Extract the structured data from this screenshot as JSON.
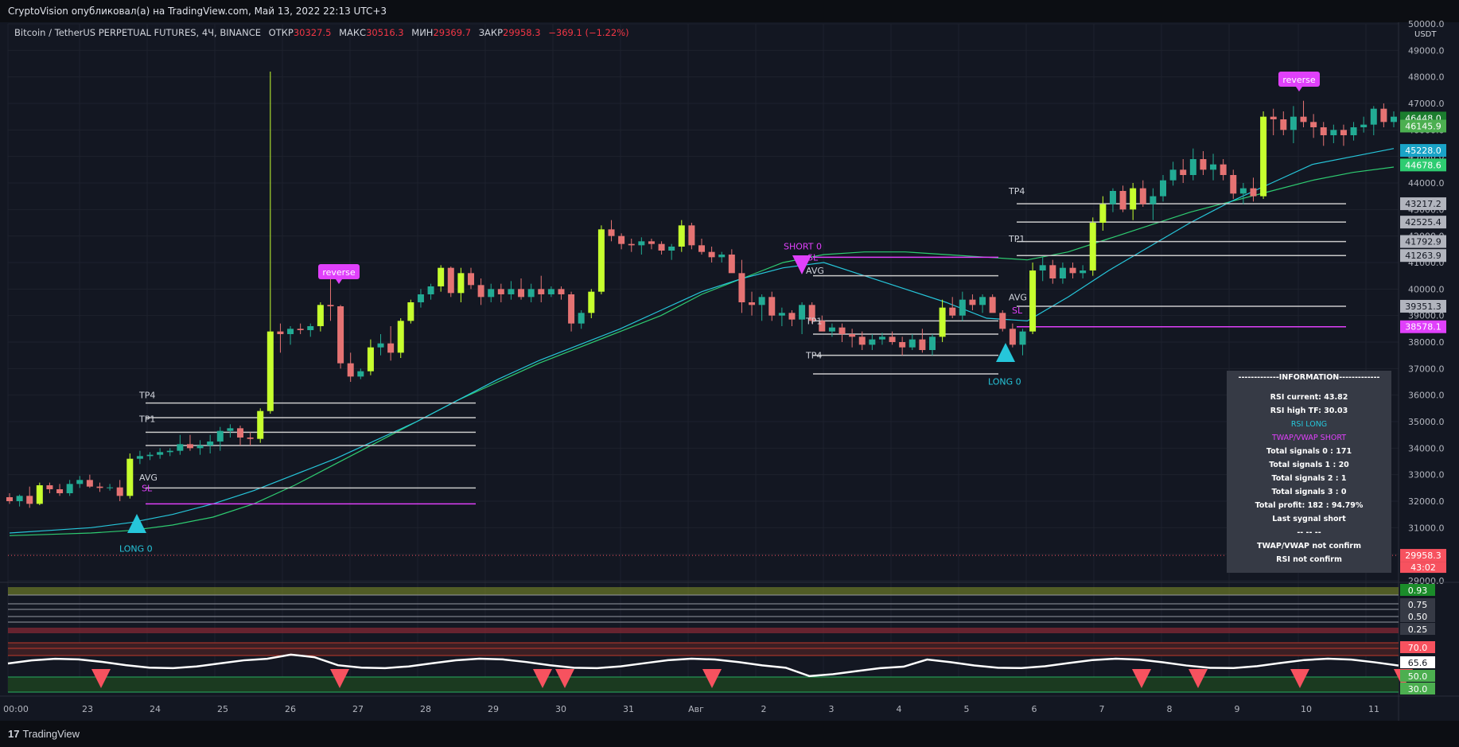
{
  "header": {
    "published": "CryptoVision опубликовал(а) на TradingView.com, Май 13, 2022 22:13 UTC+3"
  },
  "legend": {
    "symbol": "Bitcoin / TetherUS PERPETUAL FUTURES, 4Ч, BINANCE",
    "open_label": "ОТКР",
    "open": "30327.5",
    "high_label": "МАКС",
    "high": "30516.3",
    "low_label": "МИН",
    "low": "29369.7",
    "close_label": "ЗАКР",
    "close": "29958.3",
    "change": "−369.1 (−1.22%)"
  },
  "footer": {
    "brand_mark": "17",
    "brand": "TradingView"
  },
  "currency": "USDT",
  "colors": {
    "background": "#131722",
    "up": "#22ab94",
    "down": "#f23645",
    "lime": "#c6ff2e",
    "salmon": "#e57373",
    "vwap_fast": "#26c6da",
    "vwap_slow": "#2ecc71",
    "magenta": "#e040fb",
    "level": "#c9c9c9",
    "cyan_marker": "#26c6da"
  },
  "info_panel": {
    "title": "-------------INFORMATION-------------",
    "rsi_current": "RSI current: 43.82",
    "rsi_high": "RSI high TF: 30.03",
    "rsi_long": "RSI LONG",
    "twap_short": "TWAP/VWAP SHORT",
    "total0": "Total signals 0 : 171",
    "total1": "Total signals 1 : 20",
    "total2": "Total signals 2 : 1",
    "total3": "Total signals 3 : 0",
    "profit": "Total profit: 182 : 94.79%",
    "last": "Last sygnal short",
    "sep": "-- -- --",
    "twap_nc": "TWAP/VWAP not confirm",
    "rsi_nc": "RSI not confirm"
  },
  "chart_data": {
    "type": "candlestick",
    "title": "Bitcoin / TetherUS PERPETUAL FUTURES, 4Ч, BINANCE",
    "x_ticks": [
      "00:00",
      "23",
      "24",
      "25",
      "26",
      "27",
      "28",
      "29",
      "30",
      "31",
      "Авг",
      "2",
      "3",
      "4",
      "5",
      "6",
      "7",
      "8",
      "9",
      "10",
      "11"
    ],
    "y_ticks": [
      29000,
      30000,
      31000,
      32000,
      33000,
      34000,
      35000,
      36000,
      37000,
      38000,
      39000,
      40000,
      41000,
      42000,
      43000,
      44000,
      45000,
      46000,
      47000,
      48000,
      49000,
      50000
    ],
    "ylim": [
      29000,
      50000
    ],
    "candles": [
      [
        32150,
        32300,
        31900,
        32000
      ],
      [
        32000,
        32250,
        31800,
        32200
      ],
      [
        32200,
        32550,
        31750,
        31900
      ],
      [
        31900,
        32700,
        31850,
        32600
      ],
      [
        32600,
        32700,
        32300,
        32450
      ],
      [
        32450,
        32650,
        32200,
        32300
      ],
      [
        32300,
        32800,
        32200,
        32650
      ],
      [
        32650,
        32950,
        32500,
        32800
      ],
      [
        32800,
        33000,
        32500,
        32550
      ],
      [
        32550,
        32700,
        32350,
        32500
      ],
      [
        32500,
        32650,
        32400,
        32520
      ],
      [
        32520,
        32800,
        32000,
        32200
      ],
      [
        32200,
        33800,
        32100,
        33600
      ],
      [
        33600,
        33900,
        33400,
        33700
      ],
      [
        33700,
        33850,
        33550,
        33750
      ],
      [
        33750,
        34000,
        33600,
        33850
      ],
      [
        33850,
        34000,
        33700,
        33900
      ],
      [
        33900,
        34500,
        33750,
        34150
      ],
      [
        34150,
        34500,
        33900,
        34000
      ],
      [
        34000,
        34300,
        33750,
        34100
      ],
      [
        34100,
        34500,
        33800,
        34250
      ],
      [
        34250,
        34800,
        33900,
        34650
      ],
      [
        34650,
        34900,
        34400,
        34750
      ],
      [
        34750,
        34850,
        34100,
        34400
      ],
      [
        34400,
        34600,
        34100,
        34350
      ],
      [
        34350,
        35500,
        34200,
        35400
      ],
      [
        35400,
        48200,
        35300,
        38400
      ],
      [
        38400,
        38700,
        37600,
        38300
      ],
      [
        38300,
        38600,
        37900,
        38500
      ],
      [
        38500,
        38700,
        38300,
        38450
      ],
      [
        38450,
        38700,
        38200,
        38600
      ],
      [
        38600,
        39500,
        38400,
        39400
      ],
      [
        39400,
        40400,
        38800,
        39350
      ],
      [
        39350,
        39400,
        37000,
        37200
      ],
      [
        37200,
        37600,
        36500,
        36700
      ],
      [
        36700,
        37000,
        36600,
        36900
      ],
      [
        36900,
        38100,
        36750,
        37800
      ],
      [
        37800,
        38300,
        37500,
        37950
      ],
      [
        37950,
        38600,
        37300,
        37600
      ],
      [
        37600,
        38900,
        37400,
        38800
      ],
      [
        38800,
        39600,
        38700,
        39500
      ],
      [
        39500,
        40000,
        39300,
        39800
      ],
      [
        39800,
        40200,
        39600,
        40100
      ],
      [
        40100,
        40900,
        39900,
        40800
      ],
      [
        40800,
        40850,
        39700,
        39850
      ],
      [
        39850,
        40800,
        39500,
        40600
      ],
      [
        40600,
        40800,
        40000,
        40150
      ],
      [
        40150,
        40400,
        39400,
        39700
      ],
      [
        39700,
        40200,
        39500,
        40000
      ],
      [
        40000,
        40200,
        39500,
        39800
      ],
      [
        39800,
        40300,
        39600,
        40000
      ],
      [
        40000,
        40400,
        39600,
        39700
      ],
      [
        39700,
        40200,
        39500,
        40000
      ],
      [
        40000,
        40500,
        39500,
        39800
      ],
      [
        39800,
        40100,
        39700,
        40000
      ],
      [
        40000,
        40100,
        39600,
        39800
      ],
      [
        39800,
        39900,
        38400,
        38700
      ],
      [
        38700,
        39200,
        38500,
        39100
      ],
      [
        39100,
        40000,
        38900,
        39900
      ],
      [
        39900,
        42400,
        39800,
        42250
      ],
      [
        42250,
        42600,
        41800,
        42000
      ],
      [
        42000,
        42100,
        41500,
        41700
      ],
      [
        41700,
        41900,
        41400,
        41650
      ],
      [
        41650,
        41950,
        41300,
        41800
      ],
      [
        41800,
        41900,
        41500,
        41700
      ],
      [
        41700,
        41800,
        41300,
        41450
      ],
      [
        41450,
        41700,
        41100,
        41600
      ],
      [
        41600,
        42600,
        41400,
        42400
      ],
      [
        42400,
        42500,
        41500,
        41650
      ],
      [
        41650,
        41900,
        41300,
        41400
      ],
      [
        41400,
        41600,
        41000,
        41200
      ],
      [
        41200,
        41400,
        41000,
        41300
      ],
      [
        41300,
        41500,
        40800,
        40600
      ],
      [
        40600,
        41100,
        39100,
        39500
      ],
      [
        39500,
        39900,
        39000,
        39400
      ],
      [
        39400,
        39800,
        38800,
        39700
      ],
      [
        39700,
        39900,
        38800,
        39000
      ],
      [
        39000,
        39300,
        38600,
        39100
      ],
      [
        39100,
        39200,
        38600,
        38850
      ],
      [
        38850,
        39500,
        38300,
        39400
      ],
      [
        39400,
        39500,
        38700,
        38800
      ],
      [
        38800,
        39000,
        38500,
        38400
      ],
      [
        38400,
        38700,
        38200,
        38550
      ],
      [
        38550,
        38700,
        38000,
        38300
      ],
      [
        38300,
        38500,
        37800,
        38200
      ],
      [
        38200,
        38400,
        37700,
        37900
      ],
      [
        37900,
        38300,
        37700,
        38100
      ],
      [
        38100,
        38350,
        37900,
        38200
      ],
      [
        38200,
        38400,
        37900,
        38000
      ],
      [
        38000,
        38200,
        37500,
        37800
      ],
      [
        37800,
        38300,
        37700,
        38100
      ],
      [
        38100,
        38500,
        37600,
        37700
      ],
      [
        37700,
        38300,
        37500,
        38200
      ],
      [
        38200,
        39600,
        38000,
        39300
      ],
      [
        39300,
        39700,
        38900,
        39000
      ],
      [
        39000,
        39900,
        38800,
        39600
      ],
      [
        39600,
        39800,
        39200,
        39400
      ],
      [
        39400,
        39800,
        39100,
        39700
      ],
      [
        39700,
        39800,
        39200,
        39100
      ],
      [
        39100,
        39200,
        38400,
        38500
      ],
      [
        38500,
        38700,
        37800,
        37900
      ],
      [
        37900,
        38500,
        37500,
        38400
      ],
      [
        38400,
        41000,
        38300,
        40700
      ],
      [
        40700,
        41200,
        40300,
        40900
      ],
      [
        40900,
        41100,
        40200,
        40400
      ],
      [
        40400,
        41000,
        40200,
        40800
      ],
      [
        40800,
        41000,
        40400,
        40600
      ],
      [
        40600,
        40900,
        40400,
        40700
      ],
      [
        40700,
        42700,
        40500,
        42500
      ],
      [
        42500,
        43500,
        42200,
        43200
      ],
      [
        43200,
        43800,
        42900,
        43700
      ],
      [
        43700,
        43900,
        42900,
        43000
      ],
      [
        43000,
        44000,
        42600,
        43800
      ],
      [
        43800,
        44100,
        43100,
        43200
      ],
      [
        43200,
        43800,
        42600,
        43500
      ],
      [
        43500,
        44300,
        43300,
        44100
      ],
      [
        44100,
        44800,
        43900,
        44500
      ],
      [
        44500,
        44900,
        44000,
        44300
      ],
      [
        44300,
        45300,
        44100,
        44900
      ],
      [
        44900,
        45200,
        44300,
        44500
      ],
      [
        44500,
        45100,
        44100,
        44700
      ],
      [
        44700,
        44900,
        44100,
        44300
      ],
      [
        44300,
        44500,
        43400,
        43600
      ],
      [
        43600,
        44000,
        43200,
        43800
      ],
      [
        43800,
        44200,
        43300,
        43500
      ],
      [
        43500,
        46700,
        43400,
        46500
      ],
      [
        46500,
        46800,
        45800,
        46400
      ],
      [
        46400,
        46700,
        45800,
        46000
      ],
      [
        46000,
        46900,
        45500,
        46500
      ],
      [
        46500,
        47100,
        46100,
        46300
      ],
      [
        46300,
        46600,
        45700,
        46100
      ],
      [
        46100,
        46300,
        45400,
        45800
      ],
      [
        45800,
        46200,
        45500,
        46000
      ],
      [
        46000,
        46200,
        45400,
        45800
      ],
      [
        45800,
        46300,
        45600,
        46100
      ],
      [
        46100,
        46500,
        45900,
        46200
      ],
      [
        46200,
        46900,
        45800,
        46800
      ],
      [
        46800,
        47000,
        46100,
        46300
      ],
      [
        46300,
        46700,
        46100,
        46500
      ]
    ],
    "vwap_fast": [
      30800,
      30900,
      31000,
      31200,
      31500,
      31900,
      32400,
      33000,
      33600,
      34300,
      35000,
      35800,
      36600,
      37300,
      37900,
      38500,
      39200,
      39900,
      40400,
      40800,
      41000,
      40500,
      40000,
      39500,
      38900,
      38800,
      39700,
      40700,
      41600,
      42500,
      43300,
      44000,
      44700,
      45000,
      45300
    ],
    "vwap_slow": [
      30700,
      30750,
      30800,
      30900,
      31100,
      31400,
      31900,
      32600,
      33400,
      34200,
      35000,
      35800,
      36500,
      37200,
      37800,
      38400,
      39000,
      39800,
      40400,
      41000,
      41300,
      41400,
      41400,
      41300,
      41200,
      41100,
      41400,
      41900,
      42400,
      42900,
      43300,
      43700,
      44100,
      44400,
      44600
    ],
    "price_labels": [
      {
        "text": "46448.0",
        "value": 46448,
        "bg": "#1b7d2e"
      },
      {
        "text": "46145.9",
        "value": 46146,
        "bg": "#4caf50"
      },
      {
        "text": "45228.0",
        "value": 45228,
        "bg": "#1aa3c7"
      },
      {
        "text": "44678.6",
        "value": 44679,
        "bg": "#2ecc71"
      },
      {
        "text": "43217.2",
        "value": 43217,
        "bg": "#b2b5be"
      },
      {
        "text": "42525.4",
        "value": 42525,
        "bg": "#b2b5be"
      },
      {
        "text": "41792.9",
        "value": 41793,
        "bg": "#b2b5be"
      },
      {
        "text": "41263.9",
        "value": 41264,
        "bg": "#b2b5be"
      },
      {
        "text": "39351.3",
        "value": 39351,
        "bg": "#b2b5be"
      },
      {
        "text": "38578.1",
        "value": 38578,
        "bg": "#e040fb"
      },
      {
        "text": "29958.3",
        "value": 29958,
        "bg": "#f7525f"
      }
    ],
    "countdown": "43:02",
    "annotations": {
      "reverse": "reverse",
      "tp4": "TP4",
      "tp1": "TP1",
      "avg": "AVG",
      "sl": "SL",
      "long0": "LONG 0",
      "short0": "SHORT 0"
    },
    "osc_levels": [
      "0.93",
      "0.75",
      "0.50",
      "0.25"
    ],
    "rsi_levels": [
      "70.0",
      "65.6",
      "50.0",
      "30.0"
    ]
  }
}
